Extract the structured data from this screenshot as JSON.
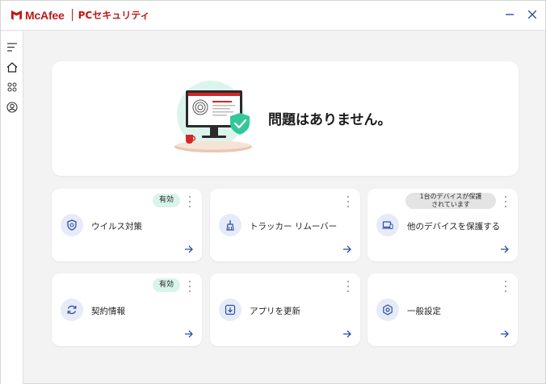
{
  "app": {
    "brand": "McAfee",
    "product": "PCセキュリティ",
    "brand_color": "#c01818",
    "accent_color": "#2b4fa8"
  },
  "window_controls": {
    "minimize": "–",
    "close": "✕"
  },
  "sidebar": {
    "items": [
      {
        "icon": "menu-icon"
      },
      {
        "icon": "home-icon",
        "active": true
      },
      {
        "icon": "apps-grid-icon"
      },
      {
        "icon": "account-icon"
      }
    ]
  },
  "hero": {
    "status_text": "問題はありません。",
    "illustration": "computer-with-fingerprint-and-shield-check"
  },
  "cards": [
    {
      "label": "ウイルス対策",
      "icon": "shield-icon",
      "badge": "有効"
    },
    {
      "label": "トラッカー リムーバー",
      "icon": "broom-icon"
    },
    {
      "label": "他のデバイスを保護する",
      "icon": "devices-icon",
      "badge_line1": "1台のデバイスが保護",
      "badge_line2": "されています"
    },
    {
      "label": "契約情報",
      "icon": "refresh-icon",
      "badge": "有効"
    },
    {
      "label": "アプリを更新",
      "icon": "download-update-icon"
    },
    {
      "label": "一般設定",
      "icon": "settings-gear-icon"
    }
  ]
}
